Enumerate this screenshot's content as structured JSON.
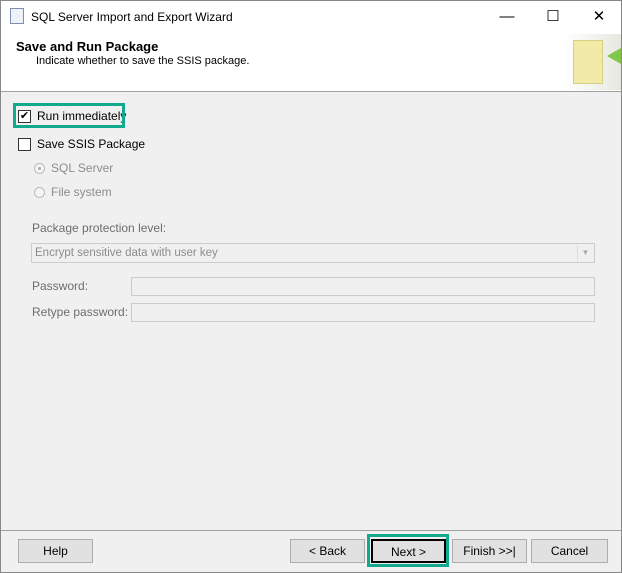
{
  "window": {
    "title": "SQL Server Import and Export Wizard"
  },
  "header": {
    "title": "Save and Run Package",
    "subtitle": "Indicate whether to save the SSIS package."
  },
  "options": {
    "run_immediately": {
      "label": "Run immediately",
      "checked": true
    },
    "save_ssis": {
      "label": "Save SSIS Package",
      "checked": false
    },
    "sql_server": {
      "label": "SQL Server",
      "selected": true
    },
    "file_system": {
      "label": "File system",
      "selected": false
    }
  },
  "protection": {
    "label": "Package protection level:",
    "value": "Encrypt sensitive data with user key"
  },
  "password": {
    "label": "Password:",
    "value": ""
  },
  "retype": {
    "label": "Retype password:",
    "value": ""
  },
  "buttons": {
    "help": "Help",
    "back": "< Back",
    "next": "Next >",
    "finish": "Finish >>|",
    "cancel": "Cancel"
  },
  "highlight_color": "#13a98d"
}
